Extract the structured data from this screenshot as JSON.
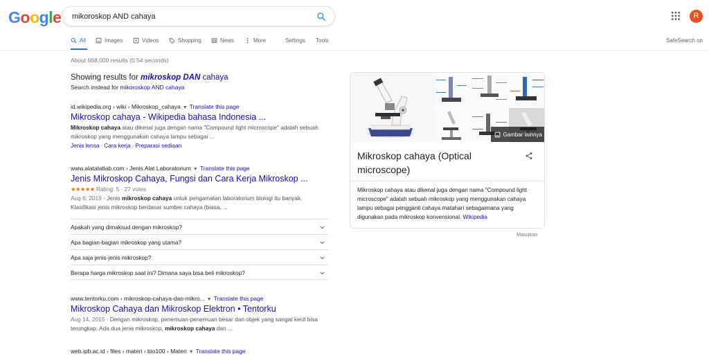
{
  "header": {
    "logo_letters": [
      {
        "ch": "G",
        "color": "#4285F4"
      },
      {
        "ch": "o",
        "color": "#EA4335"
      },
      {
        "ch": "o",
        "color": "#FBBC05"
      },
      {
        "ch": "g",
        "color": "#4285F4"
      },
      {
        "ch": "l",
        "color": "#34A853"
      },
      {
        "ch": "e",
        "color": "#EA4335"
      }
    ],
    "search_value": "mikoroskop AND cahaya",
    "avatar_letter": "R"
  },
  "tabs": {
    "all": "All",
    "images": "Images",
    "videos": "Videos",
    "shopping": "Shopping",
    "news": "News",
    "more": "More",
    "settings": "Settings",
    "tools": "Tools"
  },
  "safesearch": "SafeSearch on",
  "stats": "About 668,000 results (0.54 seconds)",
  "spelling": {
    "showing_prefix": "Showing results for ",
    "corrected_bold": "mikroskop DAN",
    "corrected_rest": " cahaya",
    "instead_prefix": "Search instead for ",
    "instead_link": "mikoroskop AND cahaya"
  },
  "results": [
    {
      "cite": "id.wikipedia.org › wiki › Mikroskop_cahaya",
      "translate": "Translate this page",
      "title": "Mikroskop cahaya - Wikipedia bahasa Indonesia ...",
      "snippet_bold": "Mikroskop cahaya",
      "snippet_rest": " atau dikenal juga dengan nama \"Compound light microscope\" adalah sebuah mikroskop yang menggunakan cahaya lampu sebagai ...",
      "sitelinks": [
        "Jenis lensa",
        "Cara kerja",
        "Preparasi sediaan"
      ]
    },
    {
      "cite": "www.alatalatlab.com › Jenis Alat Laboratorium",
      "translate": "Translate this page",
      "title": "Jenis Mikroskop Cahaya, Fungsi dan Cara Kerja Mikroskop ...",
      "stars": "★★★★★",
      "rating": " Rating: 5 · 27 votes",
      "snippet_date": "Aug 6, 2019 - ",
      "snippet_a": "Jenis ",
      "snippet_bold": "mikroskop cahaya",
      "snippet_rest": " untuk pengamatan laboratorium biologi itu banyak. Klasifikasi jenis mikroskop berdasar sumber cahaya (biasa, ..."
    },
    {
      "cite": "www.tentorku.com › mikroskop-cahaya-dan-mikro...",
      "translate": "Translate this page",
      "title": "Mikroskop Cahaya dan Mikroskop Elektron • Tentorku",
      "snippet_date": "Aug 14, 2015 - ",
      "snippet_a": "Dengan mikroskop, penemuan-penemuan besar dari objek yang sangat kecil bisa terungkap. Ada dua jenis mikroskop, ",
      "snippet_bold": "mikroskop cahaya",
      "snippet_rest": " dan ..."
    },
    {
      "cite": "web.ipb.ac.id › files › materi › bio100 › Materi",
      "translate": "Translate this page"
    }
  ],
  "paa": [
    "Apakah yang dimaksud dengan mikroskop?",
    "Apa bagian-bagian mikroskop yang utama?",
    "Apa saja jenis-jenis mikroskop?",
    "Berapa harga mikroskop saat ini? Dimana saya bisa beli mikroskop?"
  ],
  "knowledge_panel": {
    "more_images": "Gambar lainnya",
    "title": "Mikroskop cahaya (Optical microscope)",
    "description": "Mikroskop cahaya atau dikenal juga dengan nama \"Compound light microscope\" adalah sebuah mikroskop yang menggunakan cahaya lampu sebagai pengganti cahaya matahari sebagaimana yang digunakan pada mikroskop konvensional. ",
    "source": "Wikipedia"
  },
  "feedback": "Masukan"
}
